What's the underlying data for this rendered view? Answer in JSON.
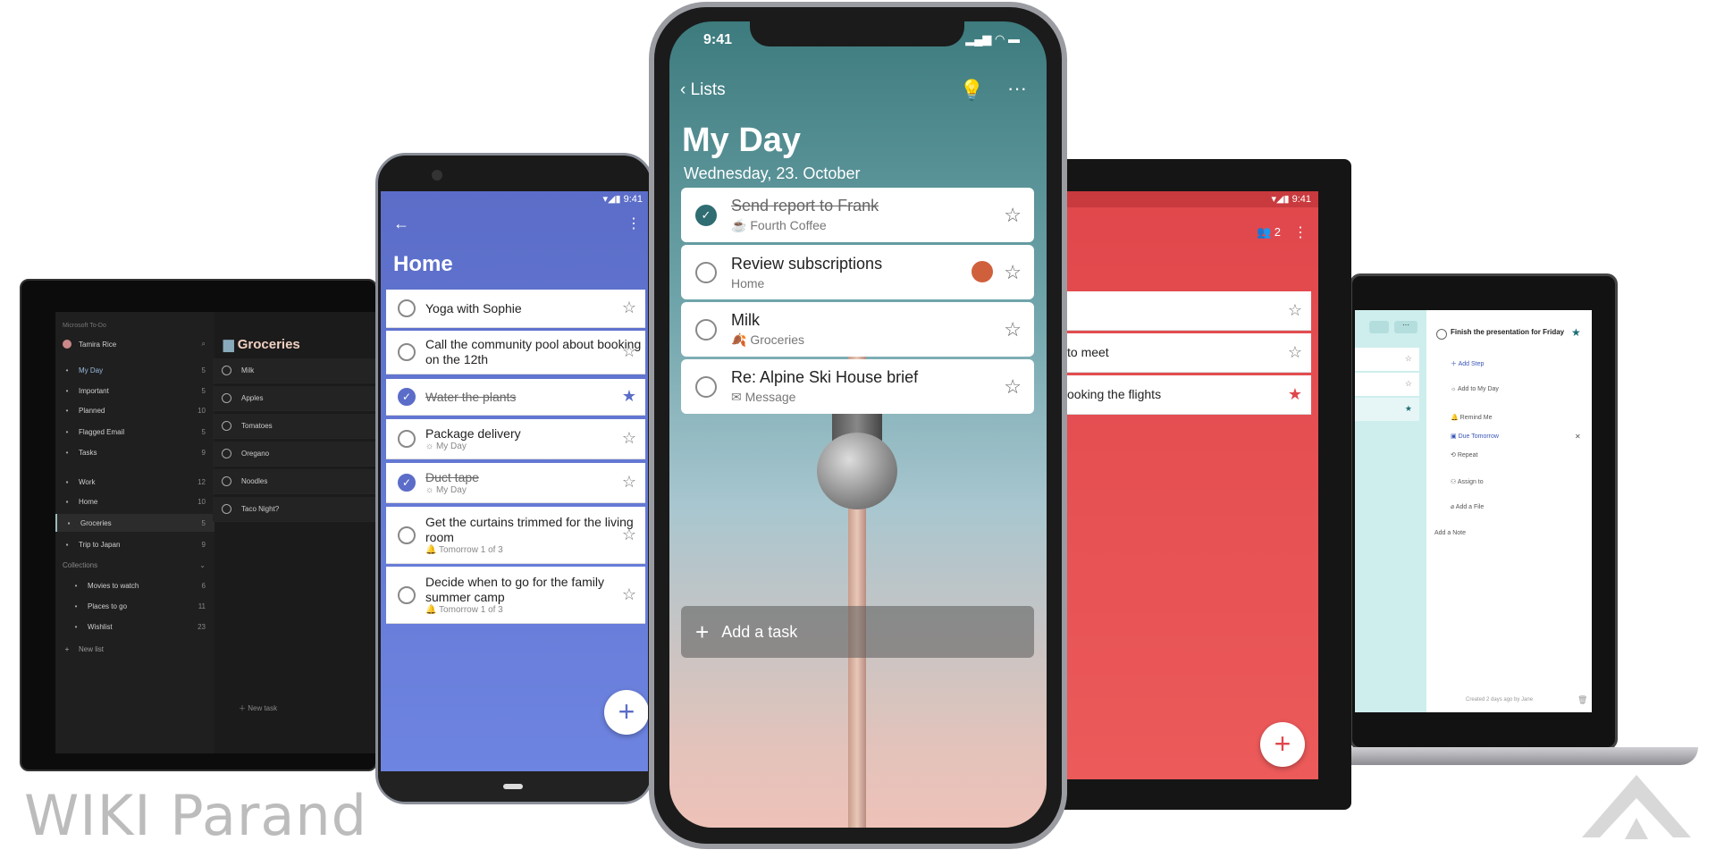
{
  "left_laptop": {
    "app_title": "Microsoft To-Do",
    "user": "Tamira Rice",
    "nav": [
      {
        "label": "My Day",
        "count": "5",
        "icon": "sun-icon"
      },
      {
        "label": "Important",
        "count": "5",
        "icon": "star-icon"
      },
      {
        "label": "Planned",
        "count": "10",
        "icon": "calendar-icon"
      },
      {
        "label": "Flagged Email",
        "count": "5",
        "icon": "flag-icon"
      },
      {
        "label": "Tasks",
        "count": "9",
        "icon": "home-icon"
      }
    ],
    "lists": [
      {
        "label": "Work",
        "count": "12"
      },
      {
        "label": "Home",
        "count": "10"
      },
      {
        "label": "Groceries",
        "count": "5"
      },
      {
        "label": "Trip to Japan",
        "count": "9"
      }
    ],
    "collections_label": "Collections",
    "collections": [
      {
        "label": "Movies to watch",
        "count": "6"
      },
      {
        "label": "Places to go",
        "count": "11"
      },
      {
        "label": "Wishlist",
        "count": "23"
      }
    ],
    "new_list": "New list",
    "list_title": "Groceries",
    "tasks": [
      "Milk",
      "Apples",
      "Tomatoes",
      "Oregano",
      "Noodles",
      "Taco Night?"
    ],
    "new_task": "New task"
  },
  "left_phone": {
    "time": "9:41",
    "title": "Home",
    "accent": "#5b6dc8",
    "tasks": [
      {
        "title": "Yoga with Sophie",
        "sub": "",
        "done": false,
        "starred": false
      },
      {
        "title": "Call the community pool about booking on the 12th",
        "sub": "",
        "done": false,
        "starred": false
      },
      {
        "title": "Water the plants",
        "sub": "",
        "done": true,
        "starred": true
      },
      {
        "title": "Package delivery",
        "sub": "☼ My Day",
        "done": false,
        "starred": false
      },
      {
        "title": "Duct tape",
        "sub": "☼ My Day",
        "done": true,
        "starred": false
      },
      {
        "title": "Get the curtains trimmed for the living room",
        "sub": "🔔 Tomorrow  1 of 3",
        "done": false,
        "starred": false
      },
      {
        "title": "Decide when to go for the family summer camp",
        "sub": "🔔 Tomorrow  1 of 3",
        "done": false,
        "starred": false
      }
    ]
  },
  "iphone": {
    "time": "9:41",
    "back": "Lists",
    "title": "My Day",
    "date": "Wednesday, 23. October",
    "tasks": [
      {
        "title": "Send report to Frank",
        "sub": "☕ Fourth Coffee",
        "done": true
      },
      {
        "title": "Review subscriptions",
        "sub": "Home",
        "done": false
      },
      {
        "title": "Milk",
        "sub": "🍂 Groceries",
        "done": false
      },
      {
        "title": "Re: Alpine Ski House brief",
        "sub": "✉ Message",
        "done": false
      }
    ],
    "add_task": "Add a task"
  },
  "right_phone": {
    "time": "9:41",
    "members": "2",
    "accent": "#e0474c",
    "tasks": [
      {
        "title": "",
        "starred": false
      },
      {
        "title": "to meet",
        "starred": false
      },
      {
        "title": "ooking the flights",
        "starred": true
      }
    ]
  },
  "right_laptop": {
    "task_title": "Finish the presentation for Friday",
    "add_step": "Add Step",
    "add_my_day": "Add to My Day",
    "remind": "Remind Me",
    "due": "Due Tomorrow",
    "repeat": "Repeat",
    "assign": "Assign to",
    "add_file": "Add a File",
    "add_note": "Add a Note",
    "footer": "Created 2 days ago by Jane"
  },
  "watermark": "WIKI Parand"
}
